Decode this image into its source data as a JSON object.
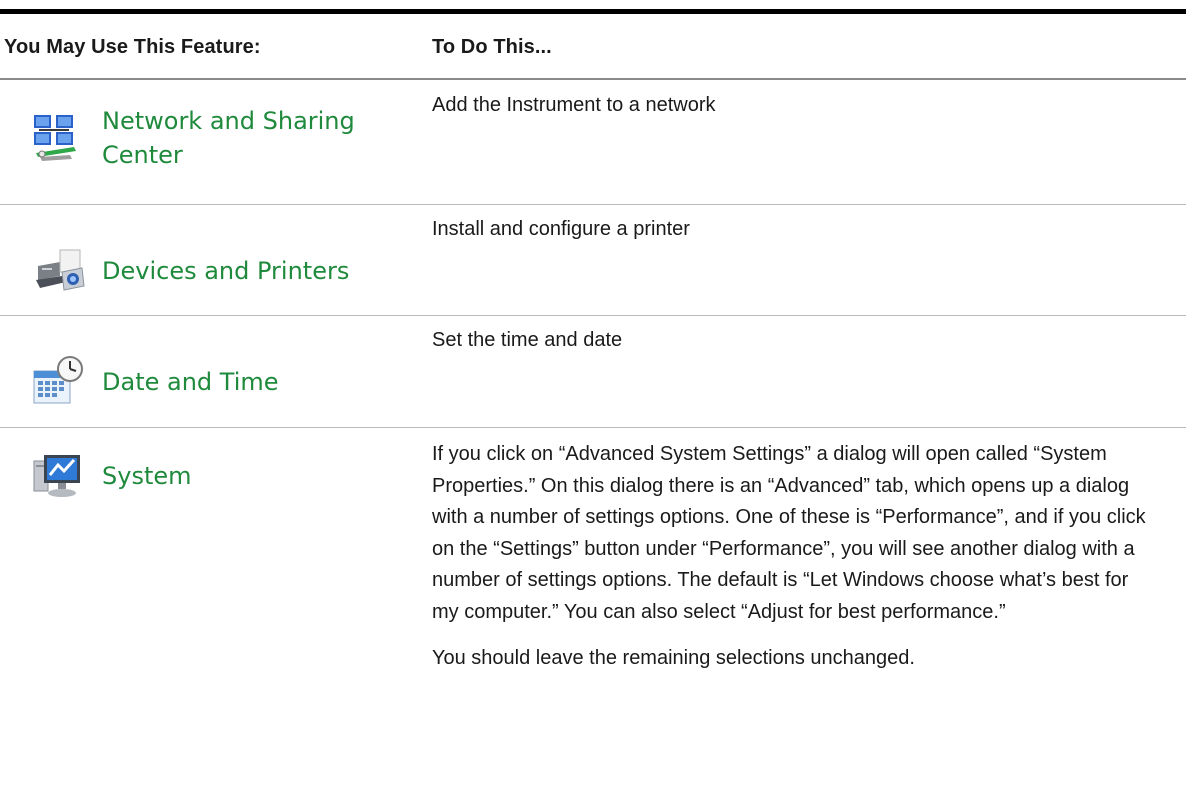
{
  "header": {
    "col1": "You May Use This Feature:",
    "col2": "To Do This..."
  },
  "rows": [
    {
      "feature": "Network and Sharing Center",
      "feature_line1": "Network and Sharing",
      "feature_line2": "Center",
      "icon": "network-sharing-icon",
      "description": "Add the Instrument to a network"
    },
    {
      "feature": "Devices and Printers",
      "icon": "devices-printers-icon",
      "description": "Install and configure a printer"
    },
    {
      "feature": "Date and Time",
      "icon": "date-time-icon",
      "description": "Set the time and date"
    },
    {
      "feature": "System",
      "icon": "system-icon",
      "description": "If you click on “Advanced System Settings” a dialog will open called “System Properties.” On this dialog there is an “Advanced” tab, which opens up a dialog with a number of settings options. One of these is “Performance”, and if you click on the “Settings” button under “Performance”, you will see another dialog with a number of settings options.   The default is “Let Windows choose what’s best for my computer.” You can also select “Adjust for best performance.”",
      "description_2": "You should leave the remaining selections unchanged."
    }
  ],
  "colors": {
    "feature_text": "#1f8a3c",
    "rule": "#000000"
  }
}
